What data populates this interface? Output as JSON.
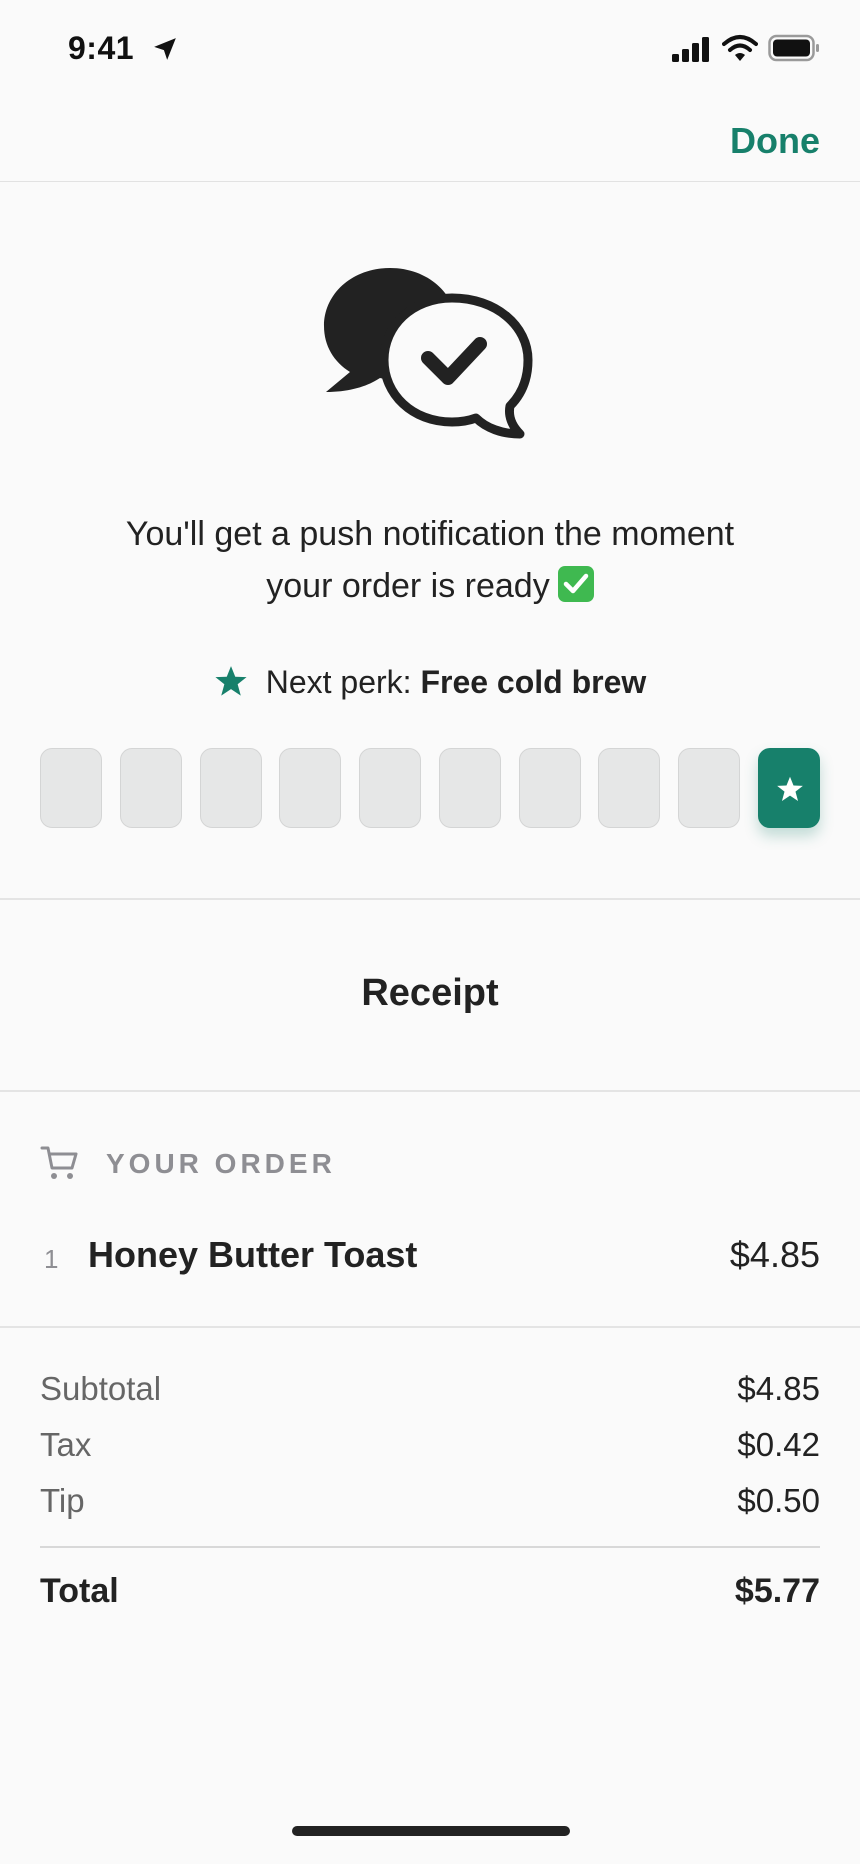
{
  "status_bar": {
    "time": "9:41",
    "icons": [
      "location-arrow-icon",
      "signal-icon",
      "wifi-icon",
      "battery-icon"
    ]
  },
  "nav": {
    "done_label": "Done",
    "accent_color": "#17806b"
  },
  "hero": {
    "icon": "chat-bubbles-check-icon",
    "message_line1": "You'll get a push notification the moment",
    "message_line2": "your order is ready",
    "emoji": "✅"
  },
  "perk": {
    "label": "Next perk: ",
    "value": "Free cold brew",
    "icon": "star-icon",
    "punches_total": 10,
    "punches_filled": 1
  },
  "receipt": {
    "title": "Receipt",
    "section_label": "YOUR ORDER",
    "section_icon": "cart-icon",
    "items": [
      {
        "qty": "1",
        "name": "Honey Butter Toast",
        "price": "$4.85"
      }
    ],
    "summary": [
      {
        "label": "Subtotal",
        "value": "$4.85"
      },
      {
        "label": "Tax",
        "value": "$0.42"
      },
      {
        "label": "Tip",
        "value": "$0.50"
      }
    ],
    "total": {
      "label": "Total",
      "value": "$5.77"
    }
  }
}
